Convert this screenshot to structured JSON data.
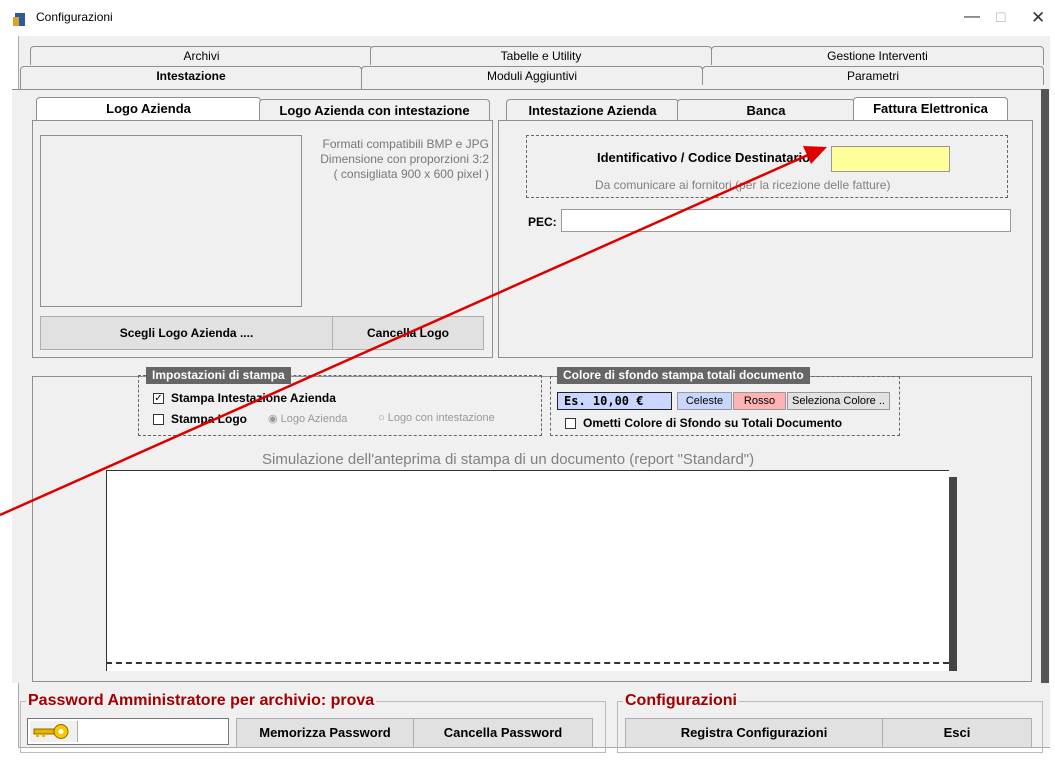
{
  "window": {
    "title": "Configurazioni"
  },
  "main_tabs": {
    "row1": [
      "Archivi",
      "Tabelle e Utility",
      "Gestione Interventi"
    ],
    "row2": [
      "Intestazione",
      "Moduli Aggiuntivi",
      "Parametri"
    ]
  },
  "logo_panel": {
    "tabs": [
      "Logo Azienda",
      "Logo Azienda con intestazione"
    ],
    "hint_lines": [
      "Formati compatibili BMP e JPG",
      "Dimensione con proporzioni 3:2",
      "( consigliata 900 x 600 pixel )"
    ],
    "choose_button": "Scegli Logo Azienda ....",
    "delete_button": "Cancella Logo"
  },
  "header_panel": {
    "tabs": [
      "Intestazione Azienda",
      "Banca",
      "Fattura Elettronica"
    ],
    "recipient_code_label": "Identificativo / Codice Destinatario:",
    "recipient_code_value": "",
    "recipient_code_hint": "Da comunicare ai fornitori (per la ricezione delle fatture)",
    "pec_label": "PEC:",
    "pec_value": ""
  },
  "print_settings": {
    "legend": "Impostazioni di stampa",
    "print_header_label": "Stampa Intestazione Azienda",
    "print_header_checked": true,
    "print_logo_label": "Stampa Logo",
    "print_logo_checked": false,
    "radio_logo_azienda": "Logo Azienda",
    "radio_logo_intestazione": "Logo con intestazione"
  },
  "background_color": {
    "legend": "Colore di sfondo stampa totali documento",
    "sample_text": "Es. 10,00 €",
    "btn_celeste": "Celeste",
    "btn_rosso": "Rosso",
    "btn_select": "Seleziona Colore ..",
    "omit_label": "Ometti Colore di Sfondo su Totali Documento",
    "omit_checked": false,
    "colors": {
      "celeste": "#c9d6ff",
      "rosso": "#ffb3b3"
    }
  },
  "preview": {
    "title": "Simulazione dell'anteprima di stampa di un documento (report  \"Standard\")"
  },
  "password_group": {
    "title": "Password Amministratore per archivio: prova",
    "value": "",
    "save_button": "Memorizza Password",
    "delete_button": "Cancella Password"
  },
  "config_group": {
    "title": "Configurazioni",
    "save_button": "Registra Configurazioni",
    "exit_button": "Esci"
  },
  "annotation": {
    "arrow_color": "#dd0000"
  }
}
